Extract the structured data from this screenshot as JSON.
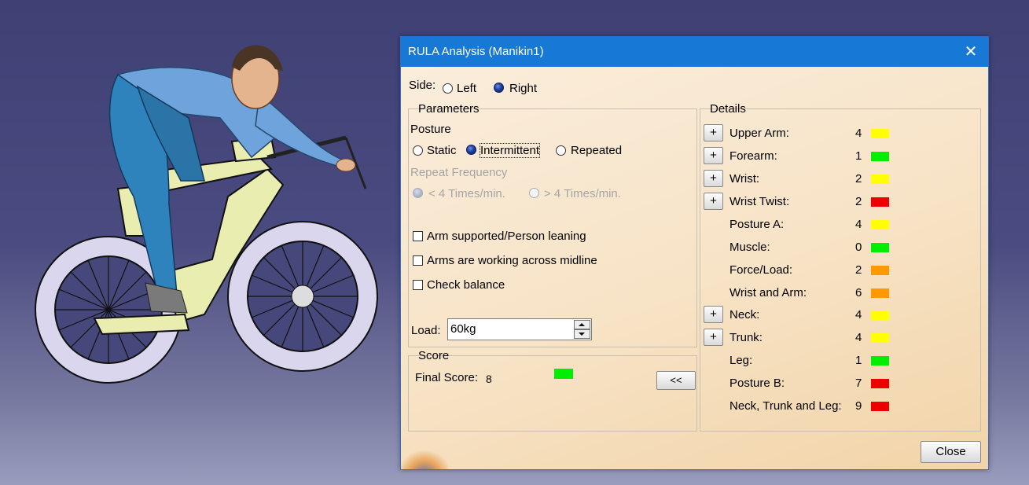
{
  "dialog": {
    "title": "RULA Analysis (Manikin1)",
    "close_glyph": "✕",
    "side": {
      "label": "Side:",
      "options": [
        "Left",
        "Right"
      ],
      "selected": "Right"
    },
    "parameters": {
      "legend": "Parameters",
      "posture_label": "Posture",
      "posture_options": [
        "Static",
        "Intermittent",
        "Repeated"
      ],
      "posture_selected": "Intermittent",
      "repeat_label": "Repeat Frequency",
      "repeat_options": [
        "< 4 Times/min.",
        "> 4 Times/min."
      ],
      "repeat_selected": "< 4 Times/min.",
      "checkboxes": [
        "Arm supported/Person leaning",
        "Arms are working across midline",
        "Check balance"
      ],
      "load_label": "Load:",
      "load_value": "60kg"
    },
    "score": {
      "legend": "Score",
      "final_label": "Final Score:",
      "final_value": "8",
      "final_color": "#00ee00",
      "collapse_label": "<<"
    },
    "details": {
      "legend": "Details",
      "plus_label": "+",
      "rows": [
        {
          "label": "Upper Arm:",
          "value": "4",
          "color": "#ffff00",
          "expandable": true
        },
        {
          "label": "Forearm:",
          "value": "1",
          "color": "#00ee00",
          "expandable": true
        },
        {
          "label": "Wrist:",
          "value": "2",
          "color": "#ffff00",
          "expandable": true
        },
        {
          "label": "Wrist Twist:",
          "value": "2",
          "color": "#ee0000",
          "expandable": true
        },
        {
          "label": "Posture A:",
          "value": "4",
          "color": "#ffff00",
          "expandable": false
        },
        {
          "label": "Muscle:",
          "value": "0",
          "color": "#00ee00",
          "expandable": false
        },
        {
          "label": "Force/Load:",
          "value": "2",
          "color": "#ff9900",
          "expandable": false
        },
        {
          "label": "Wrist and Arm:",
          "value": "6",
          "color": "#ff9900",
          "expandable": false
        },
        {
          "label": "Neck:",
          "value": "4",
          "color": "#ffff00",
          "expandable": true
        },
        {
          "label": "Trunk:",
          "value": "4",
          "color": "#ffff00",
          "expandable": true
        },
        {
          "label": "Leg:",
          "value": "1",
          "color": "#00ee00",
          "expandable": false
        },
        {
          "label": "Posture B:",
          "value": "7",
          "color": "#ee0000",
          "expandable": false
        },
        {
          "label": "Neck, Trunk and Leg:",
          "value": "9",
          "color": "#ee0000",
          "expandable": false
        }
      ]
    },
    "close_button": "Close"
  },
  "scene": {
    "subject": "manikin-cyclist"
  }
}
